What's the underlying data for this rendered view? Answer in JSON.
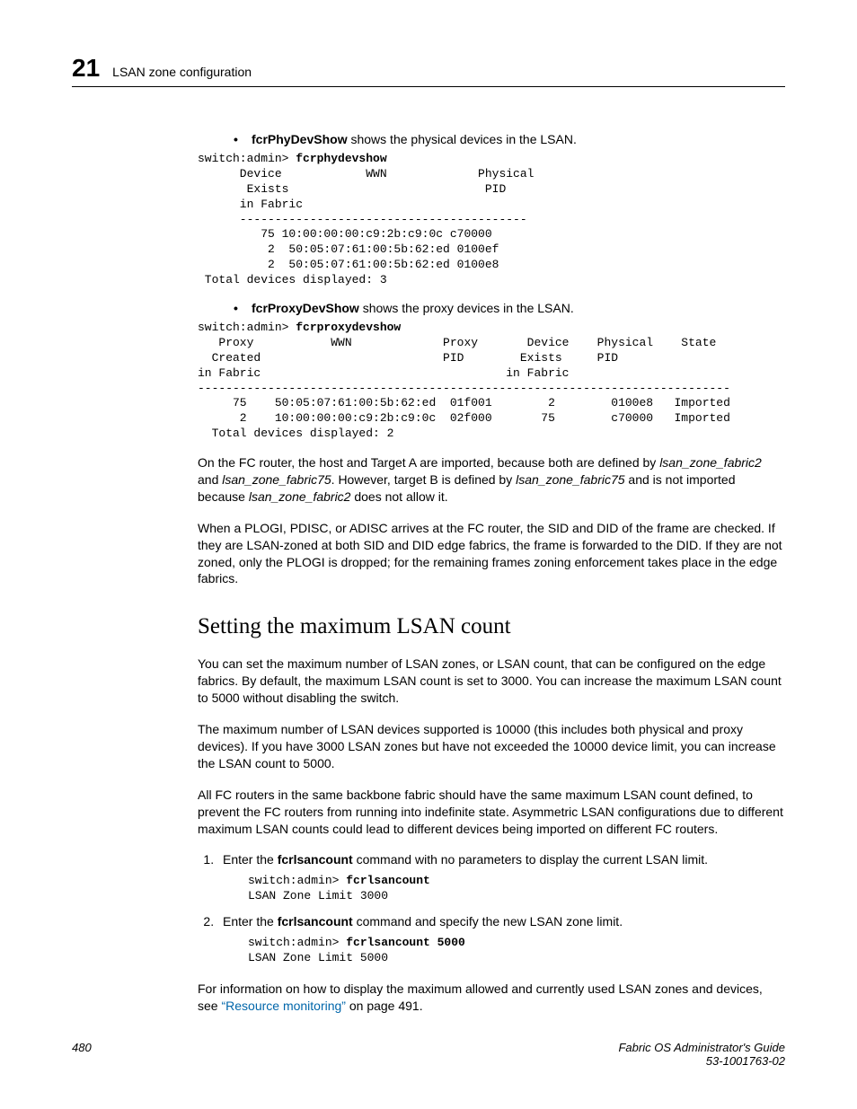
{
  "header": {
    "chapnum": "21",
    "chaptitle": "LSAN zone configuration"
  },
  "bullets": {
    "b1_cmd": "fcrPhyDevShow",
    "b1_rest": " shows the physical devices in the LSAN.",
    "b2_cmd": "fcrProxyDevShow",
    "b2_rest": " shows the proxy devices in the LSAN."
  },
  "code1": {
    "prompt": "switch:admin> ",
    "cmd": "fcrphydevshow",
    "body": "      Device            WWN             Physical\n       Exists                            PID\n      in Fabric\n      -----------------------------------------\n         75 10:00:00:00:c9:2b:c9:0c c70000\n          2  50:05:07:61:00:5b:62:ed 0100ef\n          2  50:05:07:61:00:5b:62:ed 0100e8\n Total devices displayed: 3"
  },
  "code2": {
    "prompt": "switch:admin> ",
    "cmd": "fcrproxydevshow",
    "body": "   Proxy           WWN             Proxy       Device    Physical    State\n  Created                          PID        Exists     PID\nin Fabric                                   in Fabric\n----------------------------------------------------------------------------\n     75    50:05:07:61:00:5b:62:ed  01f001        2        0100e8   Imported\n      2    10:00:00:00:c9:2b:c9:0c  02f000       75        c70000   Imported\n  Total devices displayed: 2"
  },
  "paras": {
    "p1a": "On the FC router, the host and Target A are imported, because both are defined by ",
    "p1_i1": "lsan_zone_fabric2",
    "p1b": " and ",
    "p1_i2": "lsan_zone_fabric75",
    "p1c": ". However, target B is defined by ",
    "p1_i3": "lsan_zone_fabric75",
    "p1d": " and is not imported because ",
    "p1_i4": "lsan_zone_fabric2",
    "p1e": " does not allow it.",
    "p2": "When a PLOGI, PDISC, or ADISC arrives at the FC router, the SID and DID of the frame are checked. If they are LSAN-zoned at both SID and DID edge fabrics, the frame is forwarded to the DID. If they are not zoned, only the PLOGI is dropped; for the remaining frames zoning enforcement takes place in the edge fabrics."
  },
  "section": {
    "title": "Setting the maximum LSAN count",
    "p1": "You can set the maximum number of LSAN zones, or LSAN count, that can be configured on the edge fabrics. By default, the maximum LSAN count is set to 3000. You can increase the maximum LSAN count to 5000 without disabling the switch.",
    "p2": "The maximum number of LSAN devices supported is 10000 (this includes both physical and proxy devices). If you have 3000 LSAN zones but have not exceeded the 10000 device limit, you can increase the LSAN count to 5000.",
    "p3": "All FC routers in the same backbone fabric should have the same maximum LSAN count defined, to prevent the FC routers from running into indefinite state. Asymmetric LSAN configurations due to different maximum LSAN counts could lead to different devices being imported on different FC routers.",
    "step1a": "Enter the ",
    "step1_cmd": "fcrlsancount",
    "step1b": " command with no parameters to display the current LSAN limit.",
    "code1_prompt": "switch:admin> ",
    "code1_cmd": "fcrlsancount",
    "code1_out": "LSAN Zone Limit 3000",
    "step2a": "Enter the ",
    "step2_cmd": "fcrlsancount",
    "step2b": " command and specify the new LSAN zone limit.",
    "code2_prompt": "switch:admin> ",
    "code2_cmd": "fcrlsancount 5000",
    "code2_out": "LSAN Zone Limit 5000",
    "p4a": "For information on how to display the maximum allowed and currently used LSAN zones and devices, see ",
    "p4_link": "“Resource monitoring”",
    "p4b": " on page 491."
  },
  "footer": {
    "pagenum": "480",
    "guide": "Fabric OS Administrator's Guide",
    "docnum": "53-1001763-02"
  }
}
